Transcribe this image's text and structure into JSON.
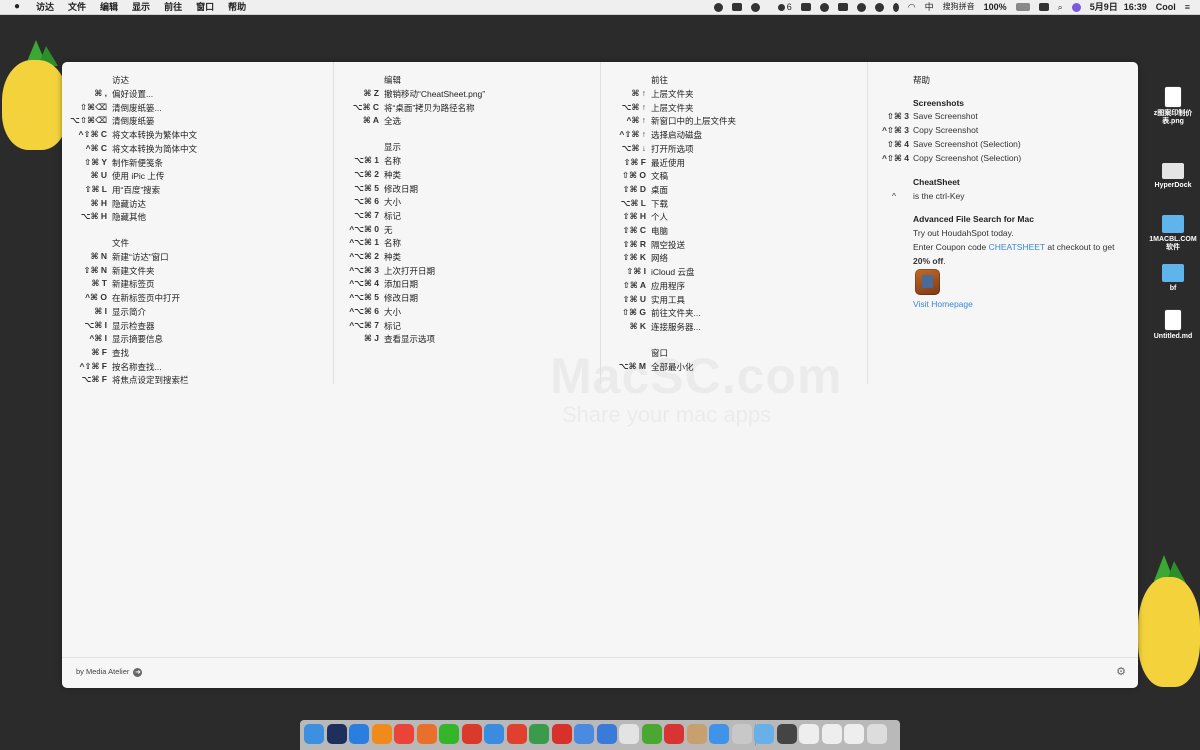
{
  "menubar": {
    "items": [
      "访达",
      "文件",
      "编辑",
      "显示",
      "前往",
      "窗口",
      "帮助"
    ],
    "tray_badge": "6",
    "input_method": "中",
    "input_method_name": "搜狗拼音",
    "battery": "100%",
    "date": "5月9日",
    "time": "16:39",
    "user": "Cool"
  },
  "watermark": {
    "line1": "MacSC.com",
    "line2": "Share your mac apps"
  },
  "col1": {
    "sections": [
      {
        "title": "访达",
        "rows": [
          {
            "keys": "⌘ ,",
            "label": "偏好设置..."
          },
          {
            "keys": "⇧⌘⌫",
            "label": "清倒废纸篓..."
          },
          {
            "keys": "⌥⇧⌘⌫",
            "label": "清倒废纸篓"
          },
          {
            "keys": "^⇧⌘ C",
            "label": "将文本转换为繁体中文"
          },
          {
            "keys": "^⌘ C",
            "label": "将文本转换为简体中文"
          },
          {
            "keys": "⇧⌘ Y",
            "label": "制作新便笺条"
          },
          {
            "keys": "⌘ U",
            "label": "使用 iPic 上传"
          },
          {
            "keys": "⇧⌘ L",
            "label": "用“百度”搜索"
          },
          {
            "keys": "⌘ H",
            "label": "隐藏访达"
          },
          {
            "keys": "⌥⌘ H",
            "label": "隐藏其他"
          }
        ]
      },
      {
        "title": "文件",
        "rows": [
          {
            "keys": "⌘ N",
            "label": "新建“访达”窗口"
          },
          {
            "keys": "⇧⌘ N",
            "label": "新建文件夹"
          },
          {
            "keys": "⌘ T",
            "label": "新建标签页"
          },
          {
            "keys": "^⌘ O",
            "label": "在新标签页中打开"
          },
          {
            "keys": "⌘ I",
            "label": "显示简介"
          },
          {
            "keys": "⌥⌘ I",
            "label": "显示检查器"
          },
          {
            "keys": "^⌘ I",
            "label": "显示摘要信息"
          },
          {
            "keys": "⌘ F",
            "label": "查找"
          },
          {
            "keys": "^⇧⌘ F",
            "label": "按名称查找..."
          },
          {
            "keys": "⌥⌘ F",
            "label": "将焦点设定到搜索栏"
          }
        ]
      }
    ]
  },
  "col2": {
    "sections": [
      {
        "title": "编辑",
        "rows": [
          {
            "keys": "⌘ Z",
            "label": "撤销移动“CheatSheet.png”"
          },
          {
            "keys": "⌥⌘ C",
            "label": "将“桌面”拷贝为路径名称"
          },
          {
            "keys": "⌘ A",
            "label": "全选"
          }
        ]
      },
      {
        "title": "显示",
        "rows": [
          {
            "keys": "⌥⌘ 1",
            "label": "名称"
          },
          {
            "keys": "⌥⌘ 2",
            "label": "种类"
          },
          {
            "keys": "⌥⌘ 5",
            "label": "修改日期"
          },
          {
            "keys": "⌥⌘ 6",
            "label": "大小"
          },
          {
            "keys": "⌥⌘ 7",
            "label": "标记"
          },
          {
            "keys": "^⌥⌘ 0",
            "label": "无"
          },
          {
            "keys": "^⌥⌘ 1",
            "label": "名称"
          },
          {
            "keys": "^⌥⌘ 2",
            "label": "种类"
          },
          {
            "keys": "^⌥⌘ 3",
            "label": "上次打开日期"
          },
          {
            "keys": "^⌥⌘ 4",
            "label": "添加日期"
          },
          {
            "keys": "^⌥⌘ 5",
            "label": "修改日期"
          },
          {
            "keys": "^⌥⌘ 6",
            "label": "大小"
          },
          {
            "keys": "^⌥⌘ 7",
            "label": "标记"
          },
          {
            "keys": "⌘ J",
            "label": "查看显示选项"
          }
        ]
      }
    ]
  },
  "col3": {
    "sections": [
      {
        "title": "前往",
        "rows": [
          {
            "keys": "⌘ ↑",
            "label": "上层文件夹"
          },
          {
            "keys": "⌥⌘ ↑",
            "label": "上层文件夹"
          },
          {
            "keys": "^⌘ ↑",
            "label": "新窗口中的上层文件夹"
          },
          {
            "keys": "^⇧⌘ ↑",
            "label": "选择启动磁盘"
          },
          {
            "keys": "⌥⌘ ↓",
            "label": "打开所选项"
          },
          {
            "keys": "⇧⌘ F",
            "label": "最近使用"
          },
          {
            "keys": "⇧⌘ O",
            "label": "文稿"
          },
          {
            "keys": "⇧⌘ D",
            "label": "桌面"
          },
          {
            "keys": "⌥⌘ L",
            "label": "下载"
          },
          {
            "keys": "⇧⌘ H",
            "label": "个人"
          },
          {
            "keys": "⇧⌘ C",
            "label": "电脑"
          },
          {
            "keys": "⇧⌘ R",
            "label": "隔空投送"
          },
          {
            "keys": "⇧⌘ K",
            "label": "网络"
          },
          {
            "keys": "⇧⌘ I",
            "label": "iCloud 云盘"
          },
          {
            "keys": "⇧⌘ A",
            "label": "应用程序"
          },
          {
            "keys": "⇧⌘ U",
            "label": "实用工具"
          },
          {
            "keys": "⇧⌘ G",
            "label": "前往文件夹..."
          },
          {
            "keys": "⌘ K",
            "label": "连接服务器..."
          }
        ]
      },
      {
        "title": "窗口",
        "rows": [
          {
            "keys": "⌥⌘ M",
            "label": "全部最小化"
          }
        ]
      }
    ]
  },
  "help": {
    "title": "帮助",
    "screenshots_title": "Screenshots",
    "screenshots": [
      {
        "keys": "⇧⌘ 3",
        "label": "Save Screenshot"
      },
      {
        "keys": "^⇧⌘ 3",
        "label": "Copy Screenshot"
      },
      {
        "keys": "⇧⌘ 4",
        "label": "Save Screenshot (Selection)"
      },
      {
        "keys": "^⇧⌘ 4",
        "label": "Copy Screenshot (Selection)"
      }
    ],
    "cheatsheet_title": "CheatSheet",
    "cheatsheet_key": "^",
    "cheatsheet_text": "is the ctrl-Key",
    "afs_title": "Advanced File Search for Mac",
    "afs_line1": "Try out HoudahSpot today.",
    "afs_line2_pre": "Enter Coupon code ",
    "afs_coupon": "CHEATSHEET",
    "afs_line2_post": " at checkout to get",
    "afs_discount": "20% off",
    "afs_period": ".",
    "visit": "Visit Homepage"
  },
  "footer": {
    "by": "by Media Atelier",
    "arrow": "➜",
    "gear": "⚙"
  },
  "desktop": [
    {
      "name": "z图案印制价表.png",
      "type": "file"
    },
    {
      "name": "HyperDock",
      "type": "drive"
    },
    {
      "name": "1MACBL.COM软件",
      "type": "folder"
    },
    {
      "name": "bf",
      "type": "folder"
    },
    {
      "name": "Untitled.md",
      "type": "file"
    }
  ],
  "dock": {
    "colors": [
      "#3d8fe0",
      "#1d2f5a",
      "#2a7ee0",
      "#f08a1c",
      "#e94437",
      "#e8702a",
      "#35b52a",
      "#d93a2a",
      "#3a8ce0",
      "#e0412f",
      "#3a9c4a",
      "#d8302a",
      "#4a8ae0",
      "#3a7ad8",
      "#e3e3e3",
      "#4aa830",
      "#d93434",
      "#c8a070",
      "#3f93e8",
      "#c8c8c8",
      "#6ab0e8",
      "#444",
      "#eee",
      "#eee",
      "#eee",
      "#ddd"
    ]
  }
}
